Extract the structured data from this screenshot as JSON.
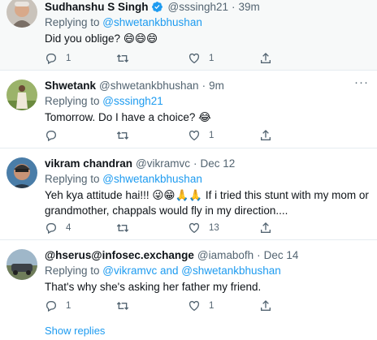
{
  "tweets": [
    {
      "name": "Sudhanshu S Singh",
      "handle": "@sssingh21",
      "time": "39m",
      "verified": true,
      "replying_prefix": "Replying to ",
      "mentions": [
        "@shwetankbhushan"
      ],
      "text": "Did you oblige? 😄😄😄",
      "counts": {
        "replies": "1",
        "retweets": "",
        "likes": "1"
      }
    },
    {
      "name": "Shwetank",
      "handle": "@shwetankbhushan",
      "time": "9m",
      "verified": false,
      "replying_prefix": "Replying to ",
      "mentions": [
        "@sssingh21"
      ],
      "text": "Tomorrow. Do I have a choice? 😂",
      "counts": {
        "replies": "",
        "retweets": "",
        "likes": "1"
      }
    },
    {
      "name": "vikram chandran",
      "handle": "@vikramvc",
      "time": "Dec 12",
      "verified": false,
      "replying_prefix": "Replying to ",
      "mentions": [
        "@shwetankbhushan"
      ],
      "text": "Yeh kya attitude hai!!! 😜😁🙏🙏  If i tried this stunt with my mom or grandmother, chappals would fly in my direction....",
      "counts": {
        "replies": "4",
        "retweets": "",
        "likes": "13"
      }
    },
    {
      "name": "@hserus@infosec.exchange",
      "handle": "@iamabofh",
      "time": "Dec 14",
      "verified": false,
      "replying_prefix": "Replying to ",
      "mentions": [
        "@vikramvc",
        "@shwetankbhushan"
      ],
      "mention_joiner": " and ",
      "text": "That's why she's asking her father my friend.",
      "counts": {
        "replies": "1",
        "retweets": "",
        "likes": "1"
      }
    }
  ],
  "show_replies_label": "Show replies",
  "colors": {
    "accent": "#1d9bf0",
    "muted": "#536471",
    "text": "#0f1419"
  },
  "icons": [
    "reply-icon",
    "retweet-icon",
    "like-icon",
    "share-icon",
    "verified-badge-icon",
    "more-icon"
  ]
}
